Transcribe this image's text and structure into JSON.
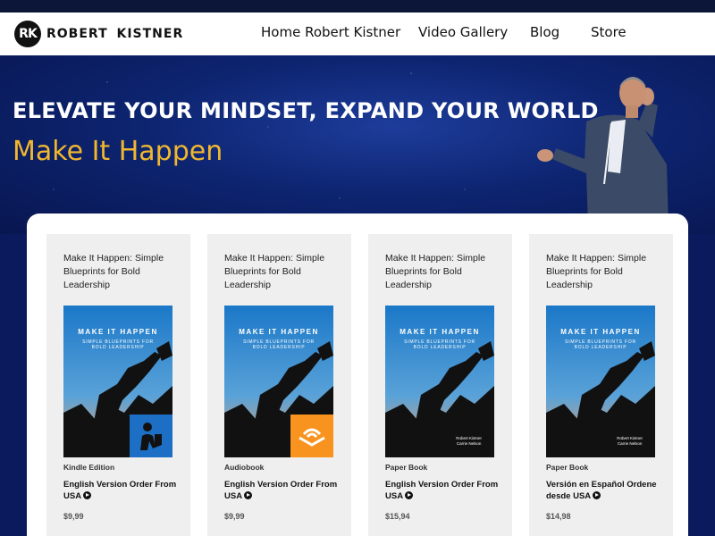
{
  "header": {
    "logo_badge": "RK",
    "logo_text": "ROBERT  KISTNER",
    "nav": [
      {
        "label": "Home Robert Kistner"
      },
      {
        "label": "Video Gallery"
      },
      {
        "label": "Blog"
      },
      {
        "label": "Store"
      }
    ]
  },
  "hero": {
    "title": "ELEVATE YOUR MINDSET, EXPAND YOUR WORLD",
    "subtitle": "Make It Happen"
  },
  "colors": {
    "hero_bg": "#0d2470",
    "accent": "#f0b72f",
    "kindle_badge": "#1d6fc6",
    "audible_badge": "#f7931e"
  },
  "book_cover": {
    "title": "MAKE IT HAPPEN",
    "subtitle": "SIMPLE BLUEPRINTS FOR BOLD LEADERSHIP",
    "authors": [
      "Robert Kistner",
      "Carrie Nelson"
    ]
  },
  "products": [
    {
      "title": "Make It Happen: Simple Blueprints for Bold Leadership",
      "edition": "Kindle Edition",
      "order": "English Version Order From USA",
      "price": "$9,99",
      "badge_icon": "kindle-reader-icon"
    },
    {
      "title": "Make It Happen: Simple Blueprints for Bold Leadership",
      "edition": "Audiobook",
      "order": "English Version Order From USA",
      "price": "$9,99",
      "badge_icon": "audible-icon"
    },
    {
      "title": "Make It Happen: Simple Blueprints for Bold Leadership",
      "edition": "Paper Book",
      "order": "English Version Order From USA",
      "price": "$15,94"
    },
    {
      "title": "Make It Happen: Simple Blueprints for Bold Leadership",
      "edition": "Paper Book",
      "order": "Versión en Español Ordene desde USA",
      "price": "$14,98"
    }
  ]
}
